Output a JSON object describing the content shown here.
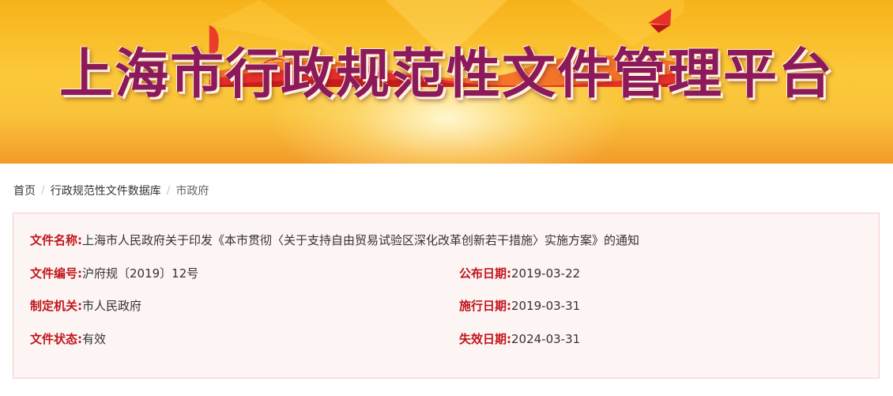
{
  "banner": {
    "title": "上海市行政规范性文件管理平台"
  },
  "breadcrumb": {
    "items": [
      "首页",
      "行政规范性文件数据库",
      "市政府"
    ]
  },
  "document": {
    "name_label": "文件名称:",
    "name_value": "上海市人民政府关于印发《本市贯彻〈关于支持自由贸易试验区深化改革创新若干措施〉实施方案》的通知",
    "number_label": "文件编号:",
    "number_value": "沪府规〔2019〕12号",
    "publish_label": "公布日期:",
    "publish_value": "2019-03-22",
    "authority_label": "制定机关:",
    "authority_value": "市人民政府",
    "effective_label": "施行日期:",
    "effective_value": "2019-03-31",
    "status_label": "文件状态:",
    "status_value": "有效",
    "expiry_label": "失效日期:",
    "expiry_value": "2024-03-31"
  },
  "colors": {
    "label_red": "#c0141a",
    "banner_yellow": "#f7b21a",
    "banner_red": "#e8302a",
    "box_border": "#f7caca",
    "box_bg": "#fdf4f4"
  }
}
